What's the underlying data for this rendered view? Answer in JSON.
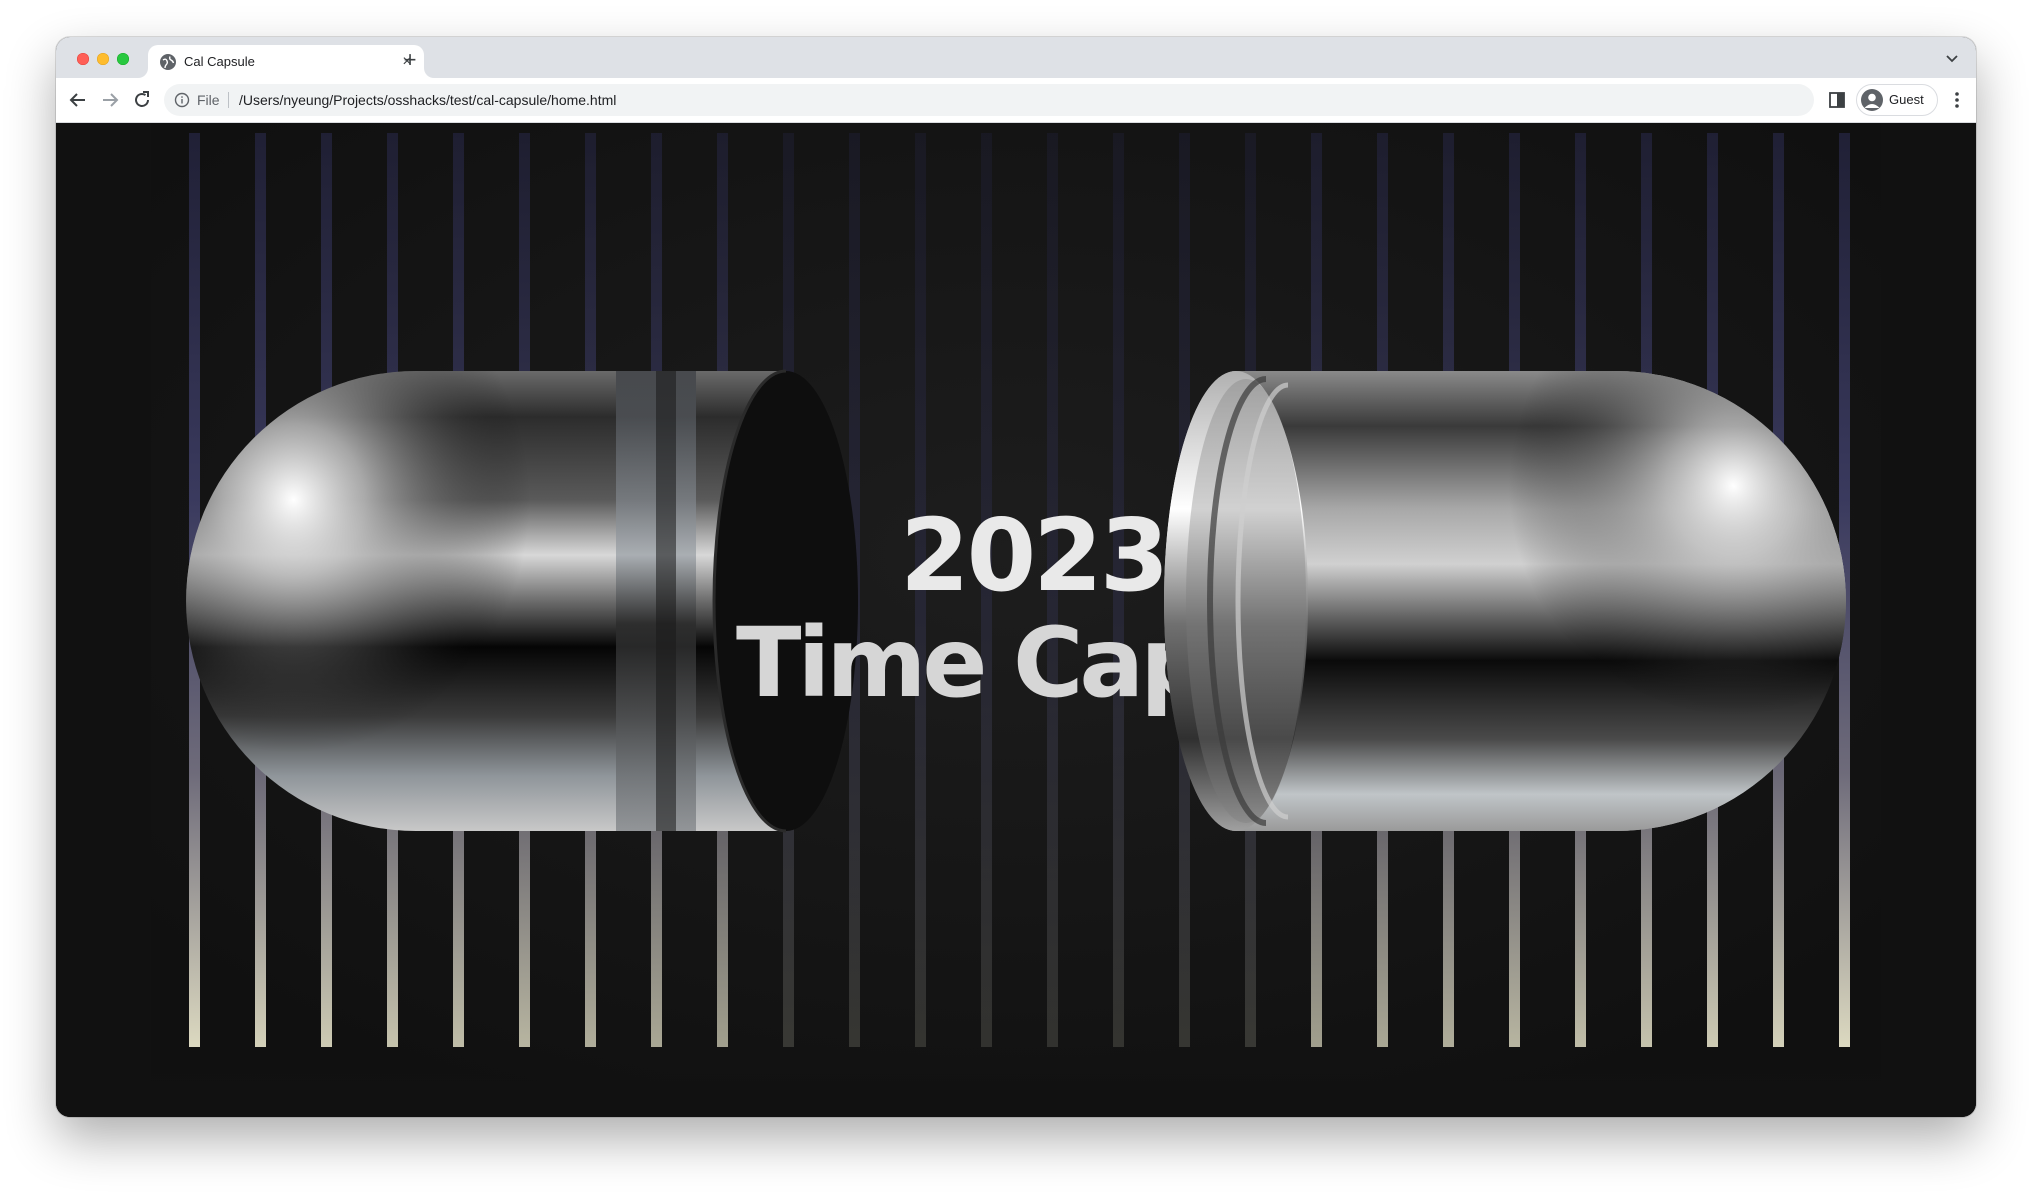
{
  "browser": {
    "tab": {
      "title": "Cal Capsule",
      "close_label": "×",
      "favicon_icon": "globe-icon"
    },
    "new_tab_label": "+",
    "address_bar": {
      "scheme": "File",
      "url": "/Users/nyeung/Projects/osshacks/test/cal-capsule/home.html"
    },
    "profile": {
      "name": "Guest"
    },
    "icons": [
      "back-arrow-icon",
      "forward-arrow-icon",
      "reload-icon",
      "info-icon",
      "side-panel-icon",
      "account-icon",
      "more-vert-icon",
      "chevron-down-icon"
    ]
  },
  "page": {
    "year": "2023",
    "tagline": "Time Caps",
    "colors": {
      "background": "#111111",
      "line_top": "#2a2a4a",
      "line_bottom": "#d9d6bf"
    }
  }
}
